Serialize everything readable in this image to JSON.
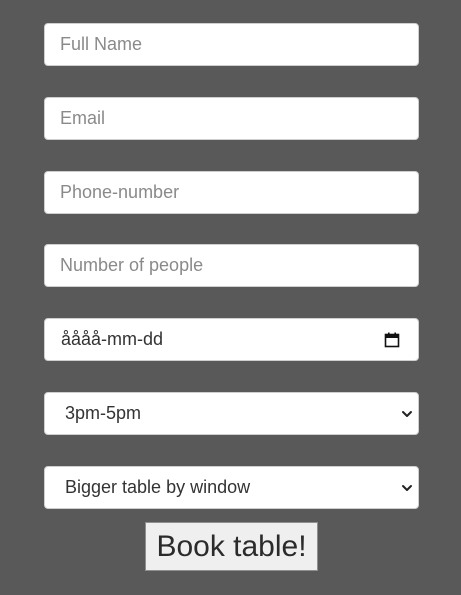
{
  "form": {
    "full_name": {
      "placeholder": "Full Name",
      "value": ""
    },
    "email": {
      "placeholder": "Email",
      "value": ""
    },
    "phone": {
      "placeholder": "Phone-number",
      "value": ""
    },
    "people": {
      "placeholder": "Number of people",
      "value": ""
    },
    "date": {
      "display": "åååå-mm-dd",
      "icon": "calendar-icon"
    },
    "time": {
      "selected": "3pm-5pm",
      "icon": "chevron-down-icon"
    },
    "table": {
      "selected": "Bigger table by window",
      "icon": "chevron-down-icon"
    },
    "submit_label": "Book table!"
  },
  "colors": {
    "background": "#595959",
    "field_background": "#ffffff",
    "placeholder_text": "#8a8a8a",
    "button_background": "#efefef"
  }
}
